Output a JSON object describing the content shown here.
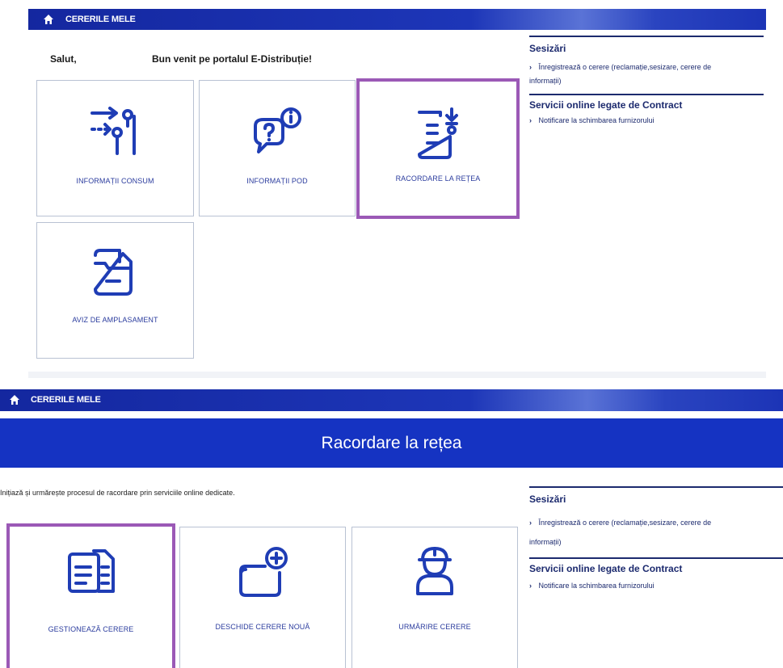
{
  "top": {
    "nav": {
      "label": "CERERILE MELE"
    },
    "greeting": "Salut,",
    "welcome": "Bun venit pe portalul E-Distribuție!",
    "tiles": [
      {
        "label": "INFORMAȚII CONSUM",
        "icon": "routing-arrows-icon"
      },
      {
        "label": "INFORMAȚII POD",
        "icon": "info-chat-icon"
      },
      {
        "label": "RACORDARE LA REȚEA",
        "icon": "document-plug-icon",
        "highlighted": true
      },
      {
        "label": "AVIZ DE AMPLASAMENT",
        "icon": "folder-minus-icon"
      }
    ],
    "sidebar": {
      "sesizari_title": "Sesizări",
      "sesizari_link_line1": "Înregistrează o cerere (reclamație,sesizare, cerere de",
      "sesizari_link_line2": "informații)",
      "contract_title": "Servicii online legate de Contract",
      "contract_link": "Notificare la schimbarea furnizorului"
    }
  },
  "bottom": {
    "nav": {
      "label": "CERERILE MELE"
    },
    "banner_title": "Racordare la rețea",
    "intro": "Inițiază și urmărește procesul de racordare prin serviciile online dedicate.",
    "tiles": [
      {
        "label": "GESTIONEAZĂ CERERE",
        "icon": "documents-icon",
        "highlighted": true
      },
      {
        "label": "DESCHIDE CERERE NOUĂ",
        "icon": "folder-plus-icon"
      },
      {
        "label": "URMĂRIRE CERERE",
        "icon": "worker-icon"
      }
    ],
    "sidebar": {
      "sesizari_title": "Sesizări",
      "sesizari_link_line1": "Înregistrează o cerere (reclamație,sesizare, cerere de",
      "sesizari_link_line2": "informații)",
      "contract_title": "Servicii online legate de Contract",
      "contract_link": "Notificare la schimbarea furnizorului"
    }
  },
  "colors": {
    "brand_blue": "#1533c2",
    "icon_blue": "#1f3db5",
    "highlight": "#9b59b6"
  }
}
